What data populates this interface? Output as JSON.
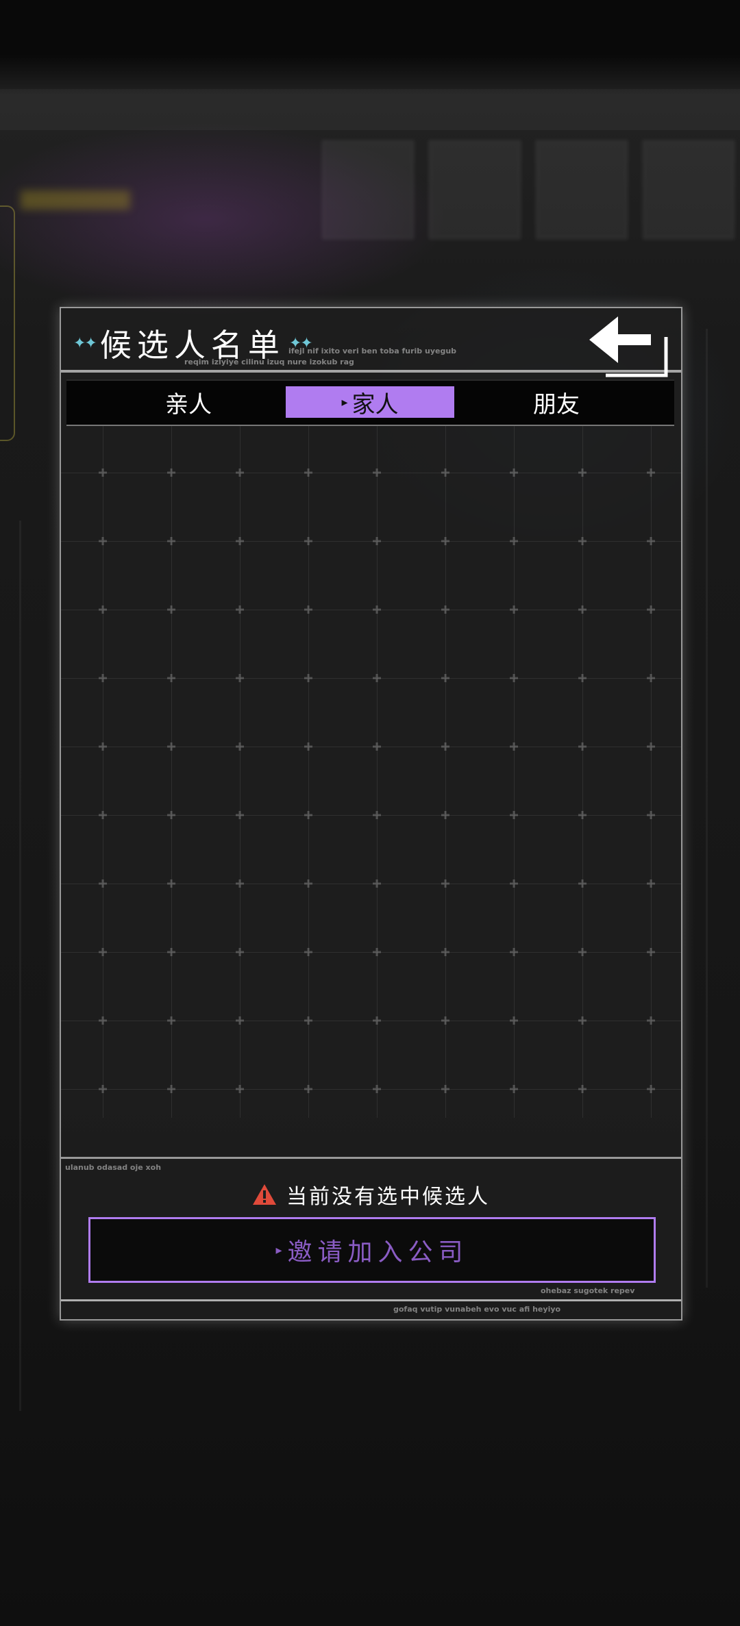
{
  "header": {
    "title": "候选人名单",
    "title_stars_left": "✦✦",
    "title_stars_right": "✦✦",
    "deco_line_1": "ifejl nif ixito veri ben toba furib uyegub",
    "deco_line_2": "reqim izlyiye cilinu izuq nure izokub rag",
    "back_button_icon": "back-arrow-icon"
  },
  "tabs": [
    {
      "label": "亲人",
      "selected": false
    },
    {
      "label": "家人",
      "selected": true
    },
    {
      "label": "朋友",
      "selected": false
    }
  ],
  "tab_selected_marker": "▸",
  "footer": {
    "deco_line_3": "ulanub odasad oje xoh",
    "status_text": "当前没有选中候选人",
    "status_icon": "warning-icon",
    "invite_marker": "▸",
    "invite_label": "邀请加入公司",
    "deco_line_4": "ohebaz sugotek repev",
    "deco_line_5": "gofaq vutip vunabeh evo vuc afi heyiyo"
  },
  "colors": {
    "accent_purple": "#b07cf0",
    "invite_text": "#8a5cc4",
    "star_cyan": "#6fc7d6",
    "warning_red": "#e04a3a"
  }
}
